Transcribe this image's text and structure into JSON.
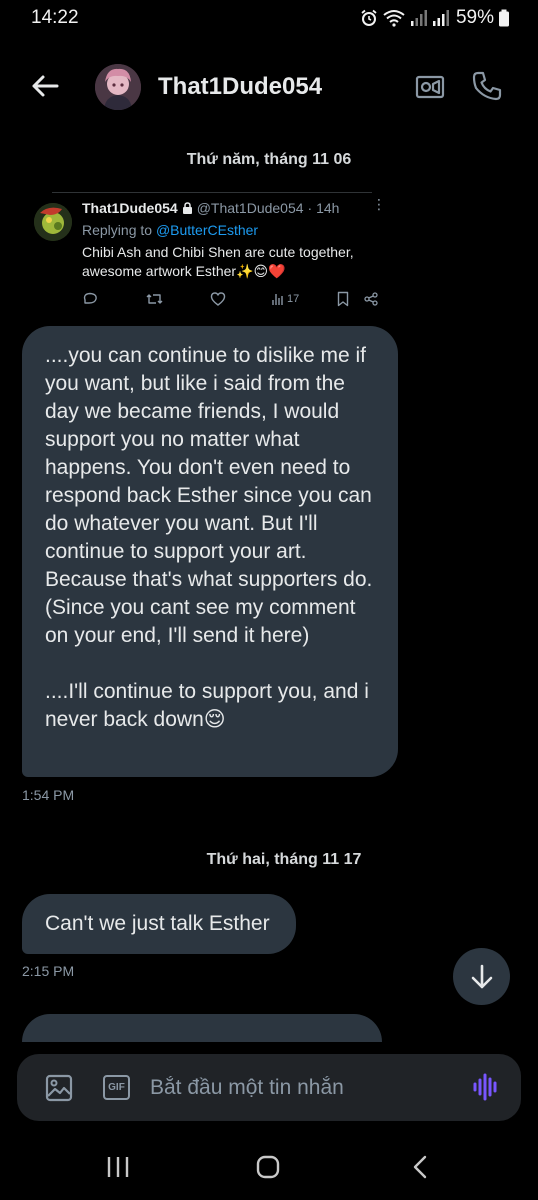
{
  "status": {
    "time": "14:22",
    "battery": "59%"
  },
  "header": {
    "name": "That1Dude054"
  },
  "dates": {
    "first": "Thứ năm, tháng 11 06",
    "second": "Thứ hai, tháng 11 17"
  },
  "tweet": {
    "name": "That1Dude054",
    "handle": "@That1Dude054",
    "age": "· 14h",
    "reply_prefix": "Replying to",
    "reply_mention": "@ButterCEsther",
    "text": "Chibi Ash and Chibi Shen are cute together, awesome artwork Esther✨😊❤️",
    "views": "17"
  },
  "messages": [
    {
      "text": "....you can continue to dislike me if you want, but like i said from the day we became friends, I would support you no matter what happens. You don't even need to respond back Esther since you can do whatever you want. But I'll continue to support your art. Because that's what supporters do.\n(Since you cant see my comment on your end, I'll send it here)\n\n....I'll continue to support you, and i never back down😌",
      "time": "1:54 PM"
    },
    {
      "text": "Can't we just talk Esther",
      "time": "2:15 PM"
    }
  ],
  "composer": {
    "placeholder": "Bắt đầu một tin nhắn",
    "gif_label": "GIF"
  },
  "colors": {
    "accent": "#1d9bf0",
    "bubble": "#2c3640",
    "voice": "#7856ff"
  }
}
